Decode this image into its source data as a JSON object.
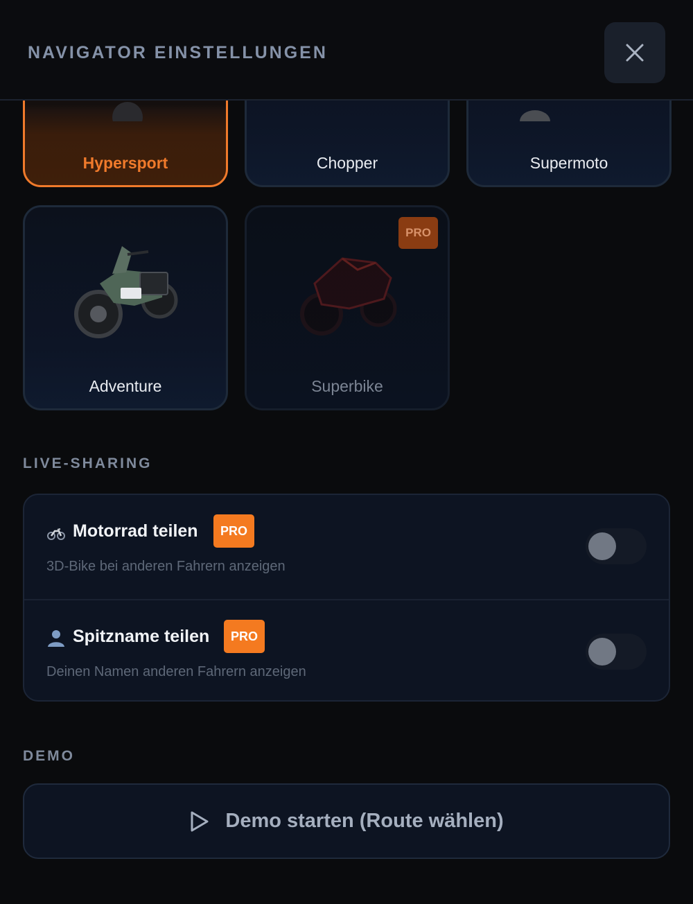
{
  "header": {
    "title": "NAVIGATOR EINSTELLUNGEN",
    "close_icon": "close-icon"
  },
  "bikes": [
    {
      "label": "Hypersport",
      "state": "selected"
    },
    {
      "label": "Chopper",
      "state": "normal"
    },
    {
      "label": "Supermoto",
      "state": "normal"
    },
    {
      "label": "Adventure",
      "state": "normal"
    },
    {
      "label": "Superbike",
      "state": "locked",
      "badge": "PRO"
    }
  ],
  "live_sharing": {
    "section_title": "LIVE-SHARING",
    "rows": [
      {
        "icon": "motorcycle-icon",
        "title": "Motorrad teilen",
        "badge": "PRO",
        "description": "3D-Bike bei anderen Fahrern anzeigen",
        "enabled": false
      },
      {
        "icon": "person-icon",
        "title": "Spitzname teilen",
        "badge": "PRO",
        "description": "Deinen Namen anderen Fahrern anzeigen",
        "enabled": false
      }
    ]
  },
  "demo": {
    "section_title": "DEMO",
    "button_label": "Demo starten (Route wählen)",
    "button_icon": "play-icon"
  },
  "colors": {
    "accent": "#f07a2b",
    "pro_badge": "#f47a20",
    "background": "#0a0b0d",
    "panel": "#0d1422"
  }
}
